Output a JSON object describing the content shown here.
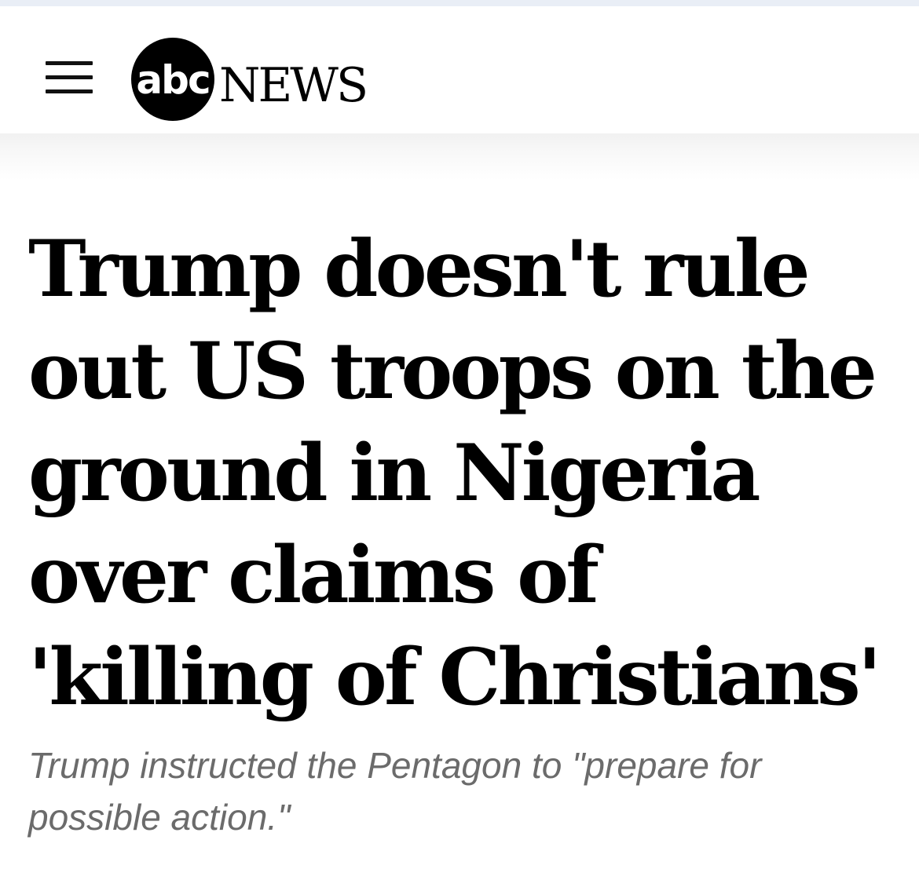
{
  "header": {
    "menu_icon": "hamburger-menu-icon",
    "logo": {
      "abc": "abc",
      "news": "NEWS"
    }
  },
  "article": {
    "headline": "Trump doesn't rule out US troops on the ground in Nigeria over claims of 'killing of Christians'",
    "subheadline": "Trump instructed the Pentagon to \"prepare for possible action.\""
  },
  "colors": {
    "headline": "#000000",
    "subheadline": "#6b6b6b",
    "logo_circle": "#000000",
    "top_strip": "#e9eef6"
  }
}
